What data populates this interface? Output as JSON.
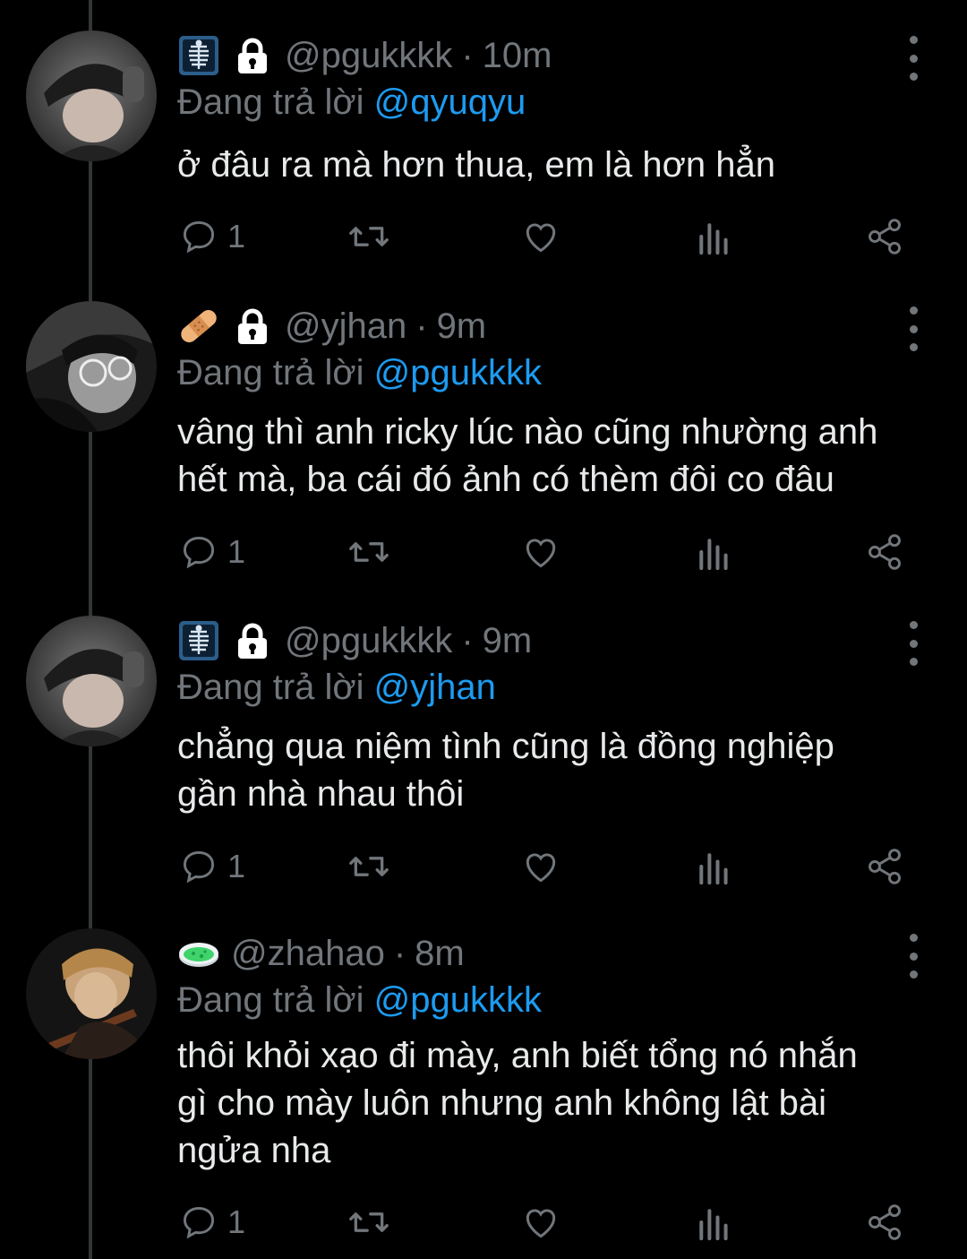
{
  "reply_prefix": "Đang trả lời",
  "tweets": [
    {
      "handle": "@pgukkkk",
      "dot": "·",
      "time": "10m",
      "emoji": "x-ray-icon",
      "reply_to": "@qyuqyu",
      "lines": [
        "ở đâu ra mà hơn thua, em là hơn hẳn"
      ],
      "reply_count": "1"
    },
    {
      "handle": "@yjhan",
      "dot": "·",
      "time": "9m",
      "emoji": "bandage-icon",
      "reply_to": "@pgukkkk",
      "lines": [
        "vâng thì anh ricky lúc nào cũng nhường anh",
        "hết mà, ba cái đó ảnh có thèm đôi co đâu"
      ],
      "reply_count": "1"
    },
    {
      "handle": "@pgukkkk",
      "dot": "·",
      "time": "9m",
      "emoji": "x-ray-icon",
      "reply_to": "@yjhan",
      "lines": [
        "chẳng qua niệm tình cũng là đồng nghiệp",
        "gần nhà nhau thôi"
      ],
      "reply_count": "1"
    },
    {
      "handle": "@zhahao",
      "dot": "·",
      "time": "8m",
      "emoji": "petri-dish-icon",
      "reply_to": "@pgukkkk",
      "lines": [
        "thôi khỏi xạo đi mày, anh biết tổng nó nhắn",
        "gì cho mày luôn nhưng anh không lật bài",
        "ngửa nha"
      ],
      "reply_count": "1"
    }
  ],
  "colors": {
    "background": "#000000",
    "text": "#e7e9ea",
    "muted": "#71767b",
    "mention": "#1d9bf0",
    "thread_line": "#333639"
  }
}
